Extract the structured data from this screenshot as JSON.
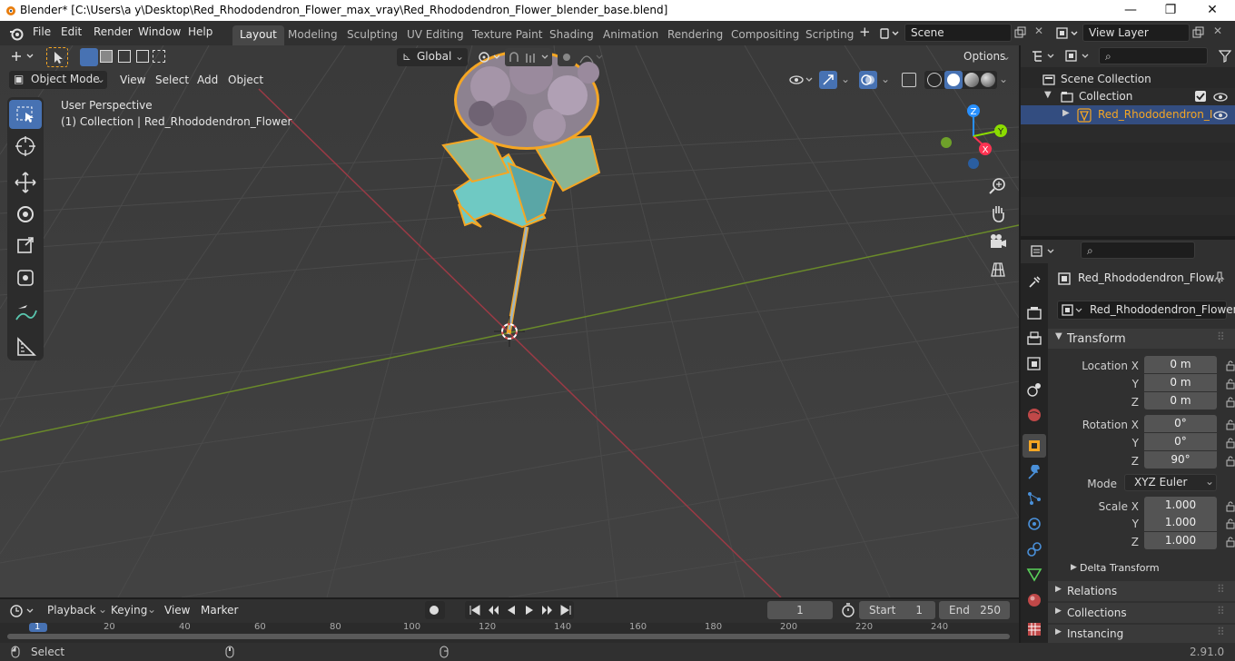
{
  "window": {
    "title": "Blender* [C:\\Users\\a y\\Desktop\\Red_Rhododendron_Flower_max_vray\\Red_Rhododendron_Flower_blender_base.blend]",
    "minimize": "—",
    "maximize": "❐",
    "close": "✕"
  },
  "menu": {
    "file": "File",
    "edit": "Edit",
    "render": "Render",
    "window": "Window",
    "help": "Help"
  },
  "workspaces": [
    "Layout",
    "Modeling",
    "Sculpting",
    "UV Editing",
    "Texture Paint",
    "Shading",
    "Animation",
    "Rendering",
    "Compositing",
    "Scripting"
  ],
  "scene": {
    "name": "Scene",
    "view_layer": "View Layer"
  },
  "viewport": {
    "mode": "Object Mode",
    "menus": {
      "view": "View",
      "select": "Select",
      "add": "Add",
      "object": "Object"
    },
    "orientation": "Global",
    "options": "Options",
    "perspective": "User Perspective",
    "collection_info": "(1) Collection | Red_Rhododendron_Flower",
    "gizmo": {
      "x": "X",
      "y": "Y",
      "z": "Z"
    }
  },
  "outliner": {
    "scene_collection": "Scene Collection",
    "collection": "Collection",
    "object": "Red_Rhododendron_I"
  },
  "properties": {
    "object_name_header": "Red_Rhododendron_Flow...",
    "object_name": "Red_Rhododendron_Flower",
    "transform_label": "Transform",
    "location_label": "Location X",
    "rotation_label": "Rotation X",
    "scale_label": "Scale X",
    "y_label": "Y",
    "z_label": "Z",
    "mode_label": "Mode",
    "location": [
      "0 m",
      "0 m",
      "0 m"
    ],
    "rotation": [
      "0°",
      "0°",
      "90°"
    ],
    "rotation_mode": "XYZ Euler",
    "scale": [
      "1.000",
      "1.000",
      "1.000"
    ],
    "delta_transform": "Delta Transform",
    "relations": "Relations",
    "collections": "Collections",
    "instancing": "Instancing"
  },
  "timeline": {
    "menus": {
      "playback": "Playback",
      "keying": "Keying",
      "view": "View",
      "marker": "Marker"
    },
    "current_frame": "1",
    "start_label": "Start",
    "start": "1",
    "end_label": "End",
    "end": "250",
    "ruler": [
      "1",
      "20",
      "40",
      "60",
      "80",
      "100",
      "120",
      "140",
      "160",
      "180",
      "200",
      "220",
      "240"
    ]
  },
  "status": {
    "select": "Select",
    "version": "2.91.0"
  },
  "colors": {
    "accent": "#4772b3",
    "selection": "#f5a623",
    "x_axis": "#ff3352",
    "y_axis": "#8bdc00",
    "z_axis": "#2890ff",
    "viewport_bg": "#3d3d3d"
  }
}
